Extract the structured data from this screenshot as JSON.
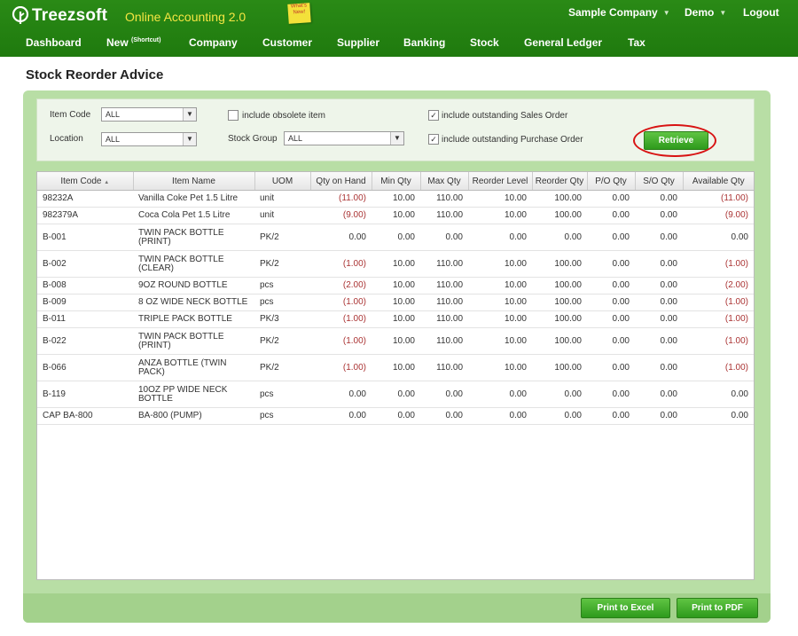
{
  "app": {
    "logo_text": "Treezsoft",
    "subtitle": "Online Accounting 2.0",
    "whats_new": "What's New!"
  },
  "topbar": {
    "company": "Sample Company",
    "user": "Demo",
    "logout": "Logout"
  },
  "nav": [
    {
      "label": "Dashboard"
    },
    {
      "label": "New",
      "sup": "(Shortcut)"
    },
    {
      "label": "Company"
    },
    {
      "label": "Customer"
    },
    {
      "label": "Supplier"
    },
    {
      "label": "Banking"
    },
    {
      "label": "Stock"
    },
    {
      "label": "General Ledger"
    },
    {
      "label": "Tax"
    }
  ],
  "page_title": "Stock Reorder Advice",
  "filters": {
    "item_code_label": "Item Code",
    "item_code_value": "ALL",
    "location_label": "Location",
    "location_value": "ALL",
    "include_obsolete": "include obsolete item",
    "include_obsolete_checked": false,
    "stock_group_label": "Stock Group",
    "stock_group_value": "ALL",
    "include_sales_order": "include outstanding Sales Order",
    "include_sales_order_checked": true,
    "include_purchase_order": "include outstanding Purchase Order",
    "include_purchase_order_checked": true,
    "retrieve": "Retrieve"
  },
  "table": {
    "columns": [
      "Item Code",
      "Item Name",
      "UOM",
      "Qty on Hand",
      "Min Qty",
      "Max Qty",
      "Reorder Level",
      "Reorder Qty",
      "P/O Qty",
      "S/O Qty",
      "Available Qty"
    ],
    "rows": [
      [
        "98232A",
        "Vanilla Coke Pet 1.5 Litre",
        "unit",
        "(11.00)",
        "10.00",
        "110.00",
        "10.00",
        "100.00",
        "0.00",
        "0.00",
        "(11.00)"
      ],
      [
        "982379A",
        "Coca Cola Pet 1.5 Litre",
        "unit",
        "(9.00)",
        "10.00",
        "110.00",
        "10.00",
        "100.00",
        "0.00",
        "0.00",
        "(9.00)"
      ],
      [
        "B-001",
        "TWIN PACK BOTTLE (PRINT)",
        "PK/2",
        "0.00",
        "0.00",
        "0.00",
        "0.00",
        "0.00",
        "0.00",
        "0.00",
        "0.00"
      ],
      [
        "B-002",
        "TWIN PACK BOTTLE (CLEAR)",
        "PK/2",
        "(1.00)",
        "10.00",
        "110.00",
        "10.00",
        "100.00",
        "0.00",
        "0.00",
        "(1.00)"
      ],
      [
        "B-008",
        "9OZ ROUND BOTTLE",
        "pcs",
        "(2.00)",
        "10.00",
        "110.00",
        "10.00",
        "100.00",
        "0.00",
        "0.00",
        "(2.00)"
      ],
      [
        "B-009",
        "8 OZ WIDE NECK BOTTLE",
        "pcs",
        "(1.00)",
        "10.00",
        "110.00",
        "10.00",
        "100.00",
        "0.00",
        "0.00",
        "(1.00)"
      ],
      [
        "B-011",
        "TRIPLE PACK BOTTLE",
        "PK/3",
        "(1.00)",
        "10.00",
        "110.00",
        "10.00",
        "100.00",
        "0.00",
        "0.00",
        "(1.00)"
      ],
      [
        "B-022",
        "TWIN PACK BOTTLE (PRINT)",
        "PK/2",
        "(1.00)",
        "10.00",
        "110.00",
        "10.00",
        "100.00",
        "0.00",
        "0.00",
        "(1.00)"
      ],
      [
        "B-066",
        "ANZA BOTTLE (TWIN PACK)",
        "PK/2",
        "(1.00)",
        "10.00",
        "110.00",
        "10.00",
        "100.00",
        "0.00",
        "0.00",
        "(1.00)"
      ],
      [
        "B-119",
        "10OZ PP WIDE NECK BOTTLE",
        "pcs",
        "0.00",
        "0.00",
        "0.00",
        "0.00",
        "0.00",
        "0.00",
        "0.00",
        "0.00"
      ],
      [
        "CAP BA-800",
        "BA-800 (PUMP)",
        "pcs",
        "0.00",
        "0.00",
        "0.00",
        "0.00",
        "0.00",
        "0.00",
        "0.00",
        "0.00"
      ]
    ],
    "sort_indicator": "▲"
  },
  "footer": {
    "print_excel": "Print to Excel",
    "print_pdf": "Print to PDF"
  }
}
